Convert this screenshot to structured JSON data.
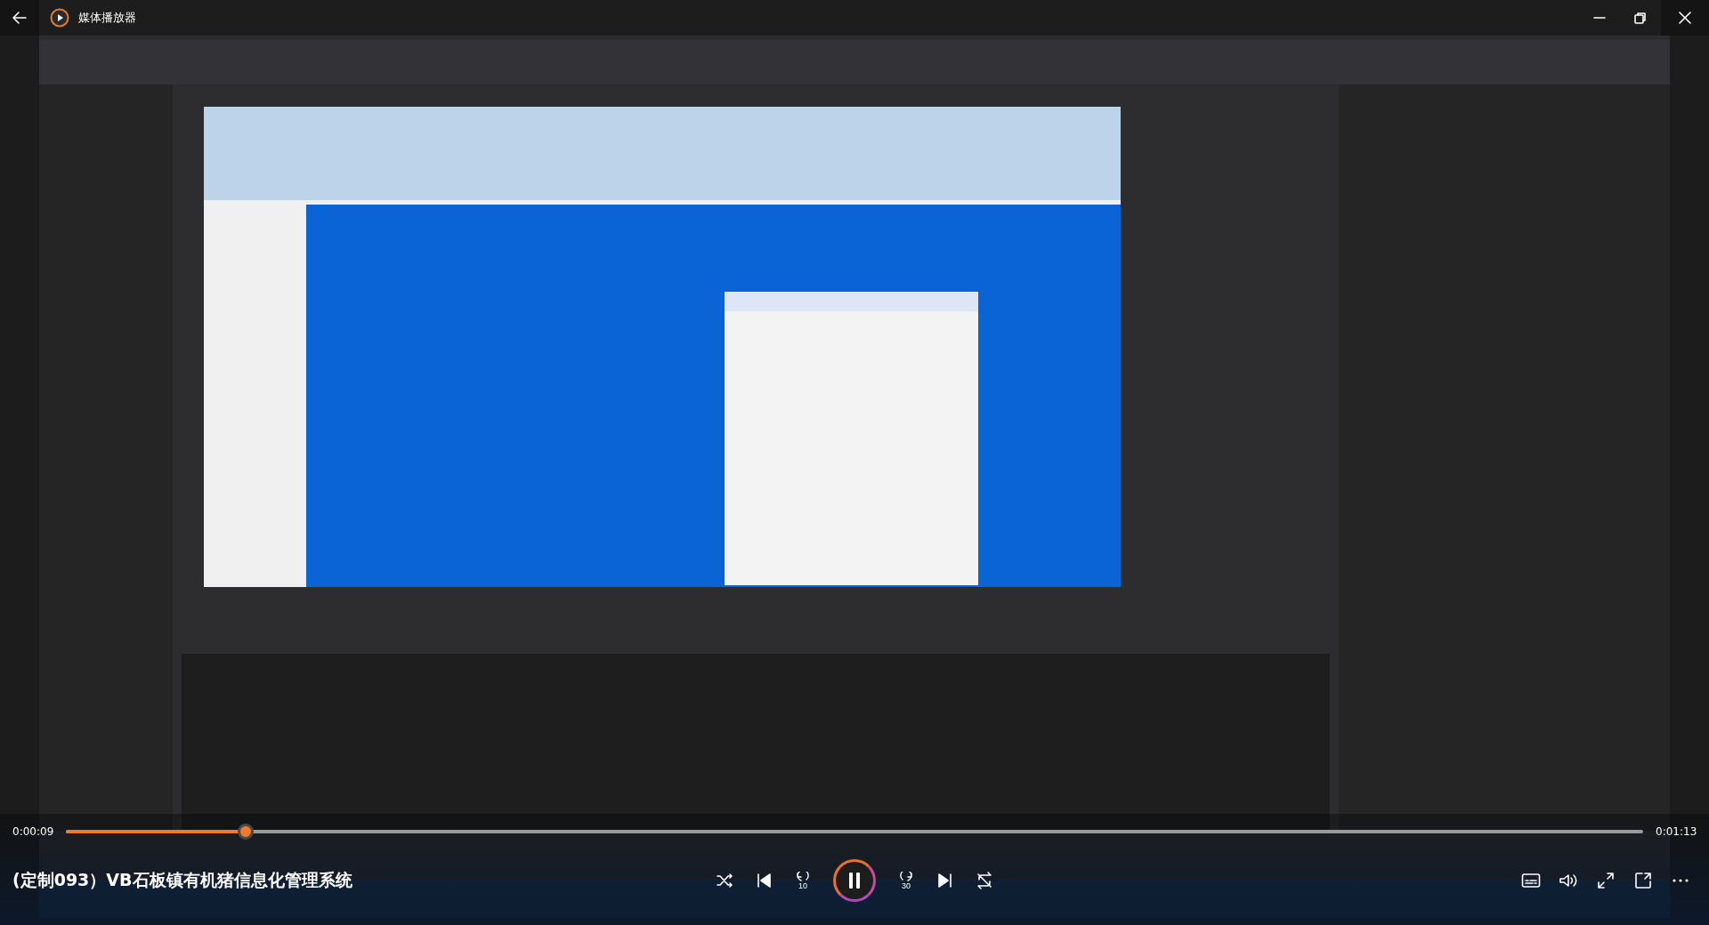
{
  "window": {
    "title": "媒体播放器"
  },
  "player": {
    "elapsed": "0:00:09",
    "duration": "0:01:13",
    "level": 0.114,
    "title": "(定制093）VB石板镇有机猪信息化管理系统",
    "playing": true,
    "controls": [
      {
        "kind": "shuffle"
      },
      {
        "kind": "previous"
      },
      {
        "kind": "skip-back",
        "label": "10"
      },
      {
        "kind": "play"
      },
      {
        "kind": "skip-forward",
        "label": "30"
      },
      {
        "kind": "next"
      },
      {
        "kind": "repeat"
      }
    ],
    "tools": [
      {
        "kind": "captions"
      },
      {
        "kind": "volume"
      },
      {
        "kind": "fullscreen"
      },
      {
        "kind": "mini"
      },
      {
        "kind": "more"
      }
    ]
  }
}
